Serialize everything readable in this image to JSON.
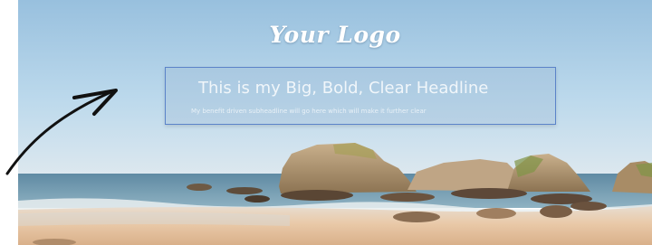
{
  "hero": {
    "logo_text": "Your Logo",
    "headline": "This is my Big, Bold, Clear Headline",
    "subheadline": "My benefit driven subheadline will go here which will make it further clear"
  },
  "icons": {
    "arrow": "hand-drawn-arrow-icon"
  },
  "colors": {
    "headline_box_border": "#5b83c9",
    "logo_text": "#ffffff",
    "sky_top": "#9ec4e0",
    "sand": "#e3c4a4"
  }
}
